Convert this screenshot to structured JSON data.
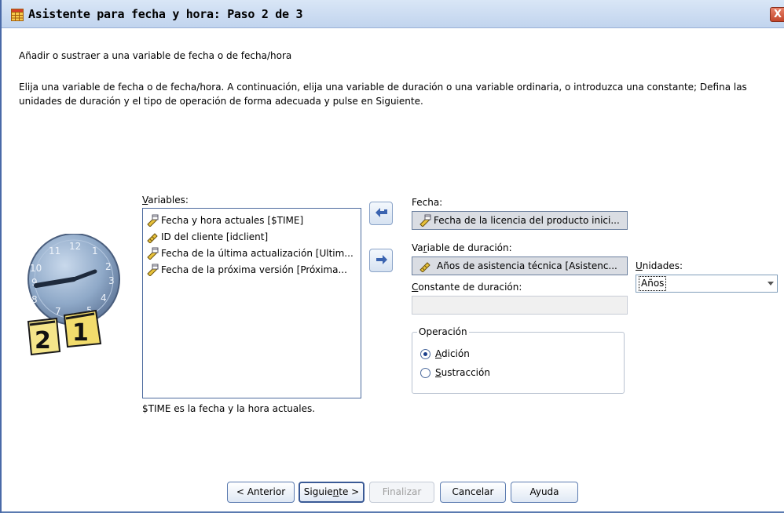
{
  "window": {
    "title": "Asistente para fecha y hora: Paso 2 de 3",
    "close_glyph": "X"
  },
  "header": {
    "subtitle": "Añadir o sustraer a una variable de fecha o de fecha/hora",
    "instructions_line1": "Elija una variable de fecha o de fecha/hora. A continuación, elija una variable de duración o una variable ordinaria, o introduzca una constante; Defina las",
    "instructions_line2": "unidades de duración y el tipo de operación de forma adecuada y pulse en Siguiente."
  },
  "variables": {
    "label": "Variables:",
    "items": [
      {
        "label": "Fecha y hora actuales [$TIME]",
        "icon": "date-ruler-icon"
      },
      {
        "label": "ID del cliente [idclient]",
        "icon": "scale-ruler-icon"
      },
      {
        "label": "Fecha de la última actualización [Ultim...",
        "icon": "date-ruler-icon"
      },
      {
        "label": "Fecha de la próxima versión [Próxima...",
        "icon": "date-ruler-icon"
      }
    ],
    "footnote": "$TIME es la fecha y la hora actuales."
  },
  "fecha": {
    "label": "Fecha:",
    "value": "Fecha de la licencia del producto inici..."
  },
  "duracion": {
    "label": "Variable de duración:",
    "value": "Años de asistencia técnica [Asistenc..."
  },
  "constante": {
    "label": "Constante de duración:",
    "value": ""
  },
  "unidades": {
    "label": "Unidades:",
    "selected": "Años"
  },
  "operacion": {
    "legend": "Operación",
    "options": [
      {
        "label": "Adición",
        "checked": true
      },
      {
        "label": "Sustracción",
        "checked": false
      }
    ]
  },
  "buttons": {
    "anterior": "< Anterior",
    "siguiente": "Siguiente >",
    "finalizar": "Finalizar",
    "cancelar": "Cancelar",
    "ayuda": "Ayuda"
  },
  "clock_art": {
    "numbers": [
      "12",
      "1",
      "2",
      "3",
      "4",
      "5",
      "6",
      "7",
      "8",
      "9",
      "10",
      "11"
    ],
    "calendar_left": "2",
    "calendar_right": "1"
  },
  "colors": {
    "accent": "#3a5a96",
    "titlebar": "#c1d4ee",
    "close": "#c2452a"
  }
}
